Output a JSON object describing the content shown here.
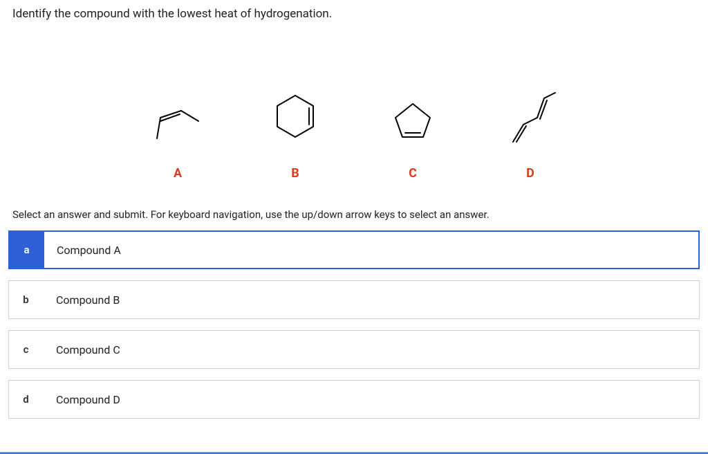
{
  "question": "Identify the compound with the lowest heat of hydrogenation.",
  "structures": {
    "A": {
      "label": "A"
    },
    "B": {
      "label": "B"
    },
    "C": {
      "label": "C"
    },
    "D": {
      "label": "D"
    }
  },
  "instructions": "Select an answer and submit. For keyboard navigation, use the up/down arrow keys to select an answer.",
  "options": [
    {
      "key": "a",
      "label": "Compound A",
      "selected": true
    },
    {
      "key": "b",
      "label": "Compound B",
      "selected": false
    },
    {
      "key": "c",
      "label": "Compound C",
      "selected": false
    },
    {
      "key": "d",
      "label": "Compound D",
      "selected": false
    }
  ]
}
